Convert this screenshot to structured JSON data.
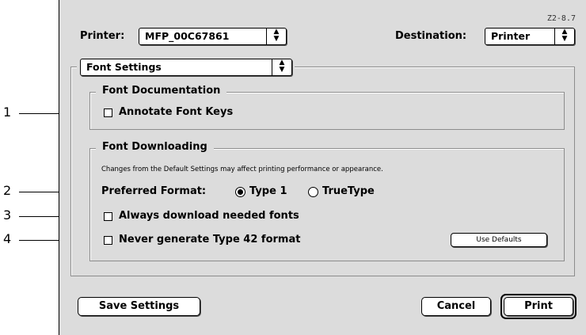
{
  "figure_id": "Z2-8.7",
  "header": {
    "printer_label": "Printer:",
    "printer_value": "MFP_00C67861",
    "destination_label": "Destination:",
    "destination_value": "Printer"
  },
  "panel_select": {
    "value": "Font Settings"
  },
  "font_documentation": {
    "title": "Font Documentation",
    "annotate_label": "Annotate Font Keys",
    "annotate_checked": false
  },
  "font_downloading": {
    "title": "Font Downloading",
    "note": "Changes from the Default Settings may affect printing performance or appearance.",
    "preferred_format_label": "Preferred Format:",
    "format_options": [
      "Type 1",
      "TrueType"
    ],
    "selected_format": "Type 1",
    "always_download_label": "Always download needed fonts",
    "always_download_checked": false,
    "never_generate_label": "Never generate Type 42 format",
    "never_generate_checked": false,
    "use_defaults_label": "Use Defaults"
  },
  "footer": {
    "save_label": "Save Settings",
    "cancel_label": "Cancel",
    "print_label": "Print"
  },
  "callouts": [
    "1",
    "2",
    "3",
    "4"
  ]
}
